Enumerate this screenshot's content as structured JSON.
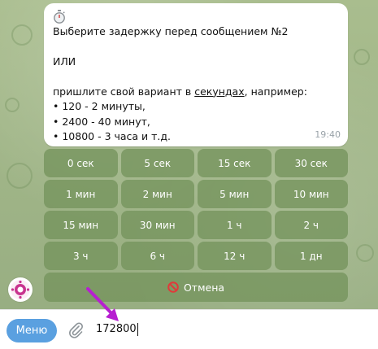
{
  "message": {
    "lines": [
      "Выберите задержку перед сообщением №2",
      "",
      "ИЛИ",
      "",
      "пришлите свой вариант в ",
      "секундах",
      ", например:",
      "• 120 - 2 минуты,",
      "• 2400 - 40 минут,",
      "• 10800 - 3 часа и т.д."
    ],
    "time": "19:40",
    "icon": "stopwatch-icon"
  },
  "keyboard": {
    "rows": [
      [
        "0 сек",
        "5 сек",
        "15 сек",
        "30 сек"
      ],
      [
        "1 мин",
        "2 мин",
        "5 мин",
        "10 мин"
      ],
      [
        "15 мин",
        "30 мин",
        "1 ч",
        "2 ч"
      ],
      [
        "3 ч",
        "6 ч",
        "12 ч",
        "1 дн"
      ]
    ],
    "cancel_label": "Отмена",
    "cancel_icon": "no-entry-icon"
  },
  "composer": {
    "menu_label": "Меню",
    "attach_icon": "paperclip-icon",
    "input_value": "172800"
  },
  "colors": {
    "key_bg": "#7a9962",
    "menu_button": "#5aa0e0",
    "arrow": "#b71fd1"
  }
}
